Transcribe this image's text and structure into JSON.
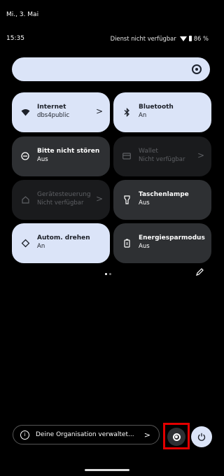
{
  "date": "Mi., 3. Mai",
  "status": {
    "time": "15:35",
    "carrier": "Dienst nicht verfügbar",
    "battery": "86 %"
  },
  "brightness": {
    "icon": "brightness-icon"
  },
  "tiles": [
    {
      "title": "Internet",
      "subtitle": "dbs4public",
      "state": "active",
      "icon": "wifi-icon",
      "chevron": ">"
    },
    {
      "title": "Bluetooth",
      "subtitle": "An",
      "state": "active",
      "icon": "bluetooth-icon"
    },
    {
      "title": "Bitte nicht stören",
      "subtitle": "Aus",
      "state": "inactive",
      "icon": "dnd-icon"
    },
    {
      "title": "Wallet",
      "subtitle": "Nicht verfügbar",
      "state": "disabled",
      "icon": "wallet-icon",
      "chevron": ">"
    },
    {
      "title": "Gerätesteuerung",
      "subtitle": "Nicht verfügbar",
      "state": "disabled",
      "icon": "home-icon",
      "chevron": ">"
    },
    {
      "title": "Taschenlampe",
      "subtitle": "Aus",
      "state": "inactive",
      "icon": "flashlight-icon"
    },
    {
      "title": "Autom. drehen",
      "subtitle": "An",
      "state": "active",
      "icon": "rotate-icon"
    },
    {
      "title": "Energiesparmodus",
      "subtitle": "Aus",
      "state": "inactive",
      "icon": "battery-saver-icon"
    }
  ],
  "footer": {
    "org_label": "Deine Organisation verwaltet...",
    "org_chevron": ">",
    "info_glyph": "i"
  },
  "colors": {
    "tile_active": "#dbe4f8",
    "tile_inactive": "#2e3033",
    "tile_disabled": "#1a1b1d",
    "highlight": "#e20000"
  }
}
